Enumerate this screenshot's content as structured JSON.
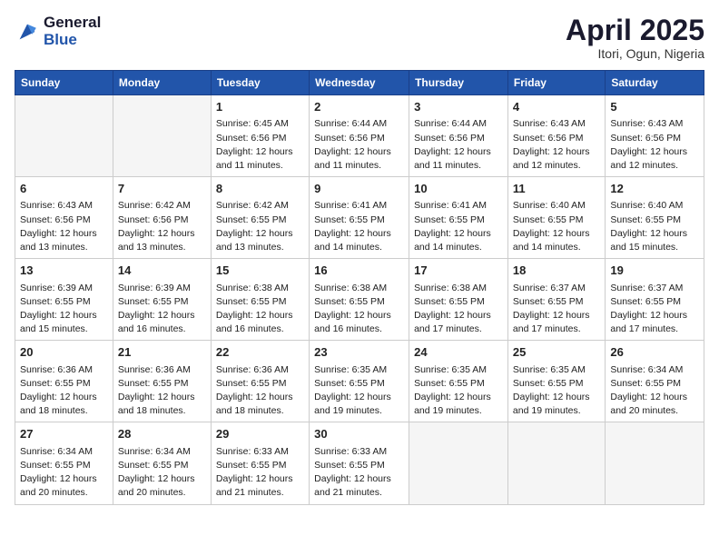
{
  "header": {
    "logo_general": "General",
    "logo_blue": "Blue",
    "month_title": "April 2025",
    "location": "Itori, Ogun, Nigeria"
  },
  "columns": [
    "Sunday",
    "Monday",
    "Tuesday",
    "Wednesday",
    "Thursday",
    "Friday",
    "Saturday"
  ],
  "weeks": [
    [
      {
        "day": "",
        "info": ""
      },
      {
        "day": "",
        "info": ""
      },
      {
        "day": "1",
        "info": "Sunrise: 6:45 AM\nSunset: 6:56 PM\nDaylight: 12 hours and 11 minutes."
      },
      {
        "day": "2",
        "info": "Sunrise: 6:44 AM\nSunset: 6:56 PM\nDaylight: 12 hours and 11 minutes."
      },
      {
        "day": "3",
        "info": "Sunrise: 6:44 AM\nSunset: 6:56 PM\nDaylight: 12 hours and 11 minutes."
      },
      {
        "day": "4",
        "info": "Sunrise: 6:43 AM\nSunset: 6:56 PM\nDaylight: 12 hours and 12 minutes."
      },
      {
        "day": "5",
        "info": "Sunrise: 6:43 AM\nSunset: 6:56 PM\nDaylight: 12 hours and 12 minutes."
      }
    ],
    [
      {
        "day": "6",
        "info": "Sunrise: 6:43 AM\nSunset: 6:56 PM\nDaylight: 12 hours and 13 minutes."
      },
      {
        "day": "7",
        "info": "Sunrise: 6:42 AM\nSunset: 6:56 PM\nDaylight: 12 hours and 13 minutes."
      },
      {
        "day": "8",
        "info": "Sunrise: 6:42 AM\nSunset: 6:55 PM\nDaylight: 12 hours and 13 minutes."
      },
      {
        "day": "9",
        "info": "Sunrise: 6:41 AM\nSunset: 6:55 PM\nDaylight: 12 hours and 14 minutes."
      },
      {
        "day": "10",
        "info": "Sunrise: 6:41 AM\nSunset: 6:55 PM\nDaylight: 12 hours and 14 minutes."
      },
      {
        "day": "11",
        "info": "Sunrise: 6:40 AM\nSunset: 6:55 PM\nDaylight: 12 hours and 14 minutes."
      },
      {
        "day": "12",
        "info": "Sunrise: 6:40 AM\nSunset: 6:55 PM\nDaylight: 12 hours and 15 minutes."
      }
    ],
    [
      {
        "day": "13",
        "info": "Sunrise: 6:39 AM\nSunset: 6:55 PM\nDaylight: 12 hours and 15 minutes."
      },
      {
        "day": "14",
        "info": "Sunrise: 6:39 AM\nSunset: 6:55 PM\nDaylight: 12 hours and 16 minutes."
      },
      {
        "day": "15",
        "info": "Sunrise: 6:38 AM\nSunset: 6:55 PM\nDaylight: 12 hours and 16 minutes."
      },
      {
        "day": "16",
        "info": "Sunrise: 6:38 AM\nSunset: 6:55 PM\nDaylight: 12 hours and 16 minutes."
      },
      {
        "day": "17",
        "info": "Sunrise: 6:38 AM\nSunset: 6:55 PM\nDaylight: 12 hours and 17 minutes."
      },
      {
        "day": "18",
        "info": "Sunrise: 6:37 AM\nSunset: 6:55 PM\nDaylight: 12 hours and 17 minutes."
      },
      {
        "day": "19",
        "info": "Sunrise: 6:37 AM\nSunset: 6:55 PM\nDaylight: 12 hours and 17 minutes."
      }
    ],
    [
      {
        "day": "20",
        "info": "Sunrise: 6:36 AM\nSunset: 6:55 PM\nDaylight: 12 hours and 18 minutes."
      },
      {
        "day": "21",
        "info": "Sunrise: 6:36 AM\nSunset: 6:55 PM\nDaylight: 12 hours and 18 minutes."
      },
      {
        "day": "22",
        "info": "Sunrise: 6:36 AM\nSunset: 6:55 PM\nDaylight: 12 hours and 18 minutes."
      },
      {
        "day": "23",
        "info": "Sunrise: 6:35 AM\nSunset: 6:55 PM\nDaylight: 12 hours and 19 minutes."
      },
      {
        "day": "24",
        "info": "Sunrise: 6:35 AM\nSunset: 6:55 PM\nDaylight: 12 hours and 19 minutes."
      },
      {
        "day": "25",
        "info": "Sunrise: 6:35 AM\nSunset: 6:55 PM\nDaylight: 12 hours and 19 minutes."
      },
      {
        "day": "26",
        "info": "Sunrise: 6:34 AM\nSunset: 6:55 PM\nDaylight: 12 hours and 20 minutes."
      }
    ],
    [
      {
        "day": "27",
        "info": "Sunrise: 6:34 AM\nSunset: 6:55 PM\nDaylight: 12 hours and 20 minutes."
      },
      {
        "day": "28",
        "info": "Sunrise: 6:34 AM\nSunset: 6:55 PM\nDaylight: 12 hours and 20 minutes."
      },
      {
        "day": "29",
        "info": "Sunrise: 6:33 AM\nSunset: 6:55 PM\nDaylight: 12 hours and 21 minutes."
      },
      {
        "day": "30",
        "info": "Sunrise: 6:33 AM\nSunset: 6:55 PM\nDaylight: 12 hours and 21 minutes."
      },
      {
        "day": "",
        "info": ""
      },
      {
        "day": "",
        "info": ""
      },
      {
        "day": "",
        "info": ""
      }
    ]
  ]
}
